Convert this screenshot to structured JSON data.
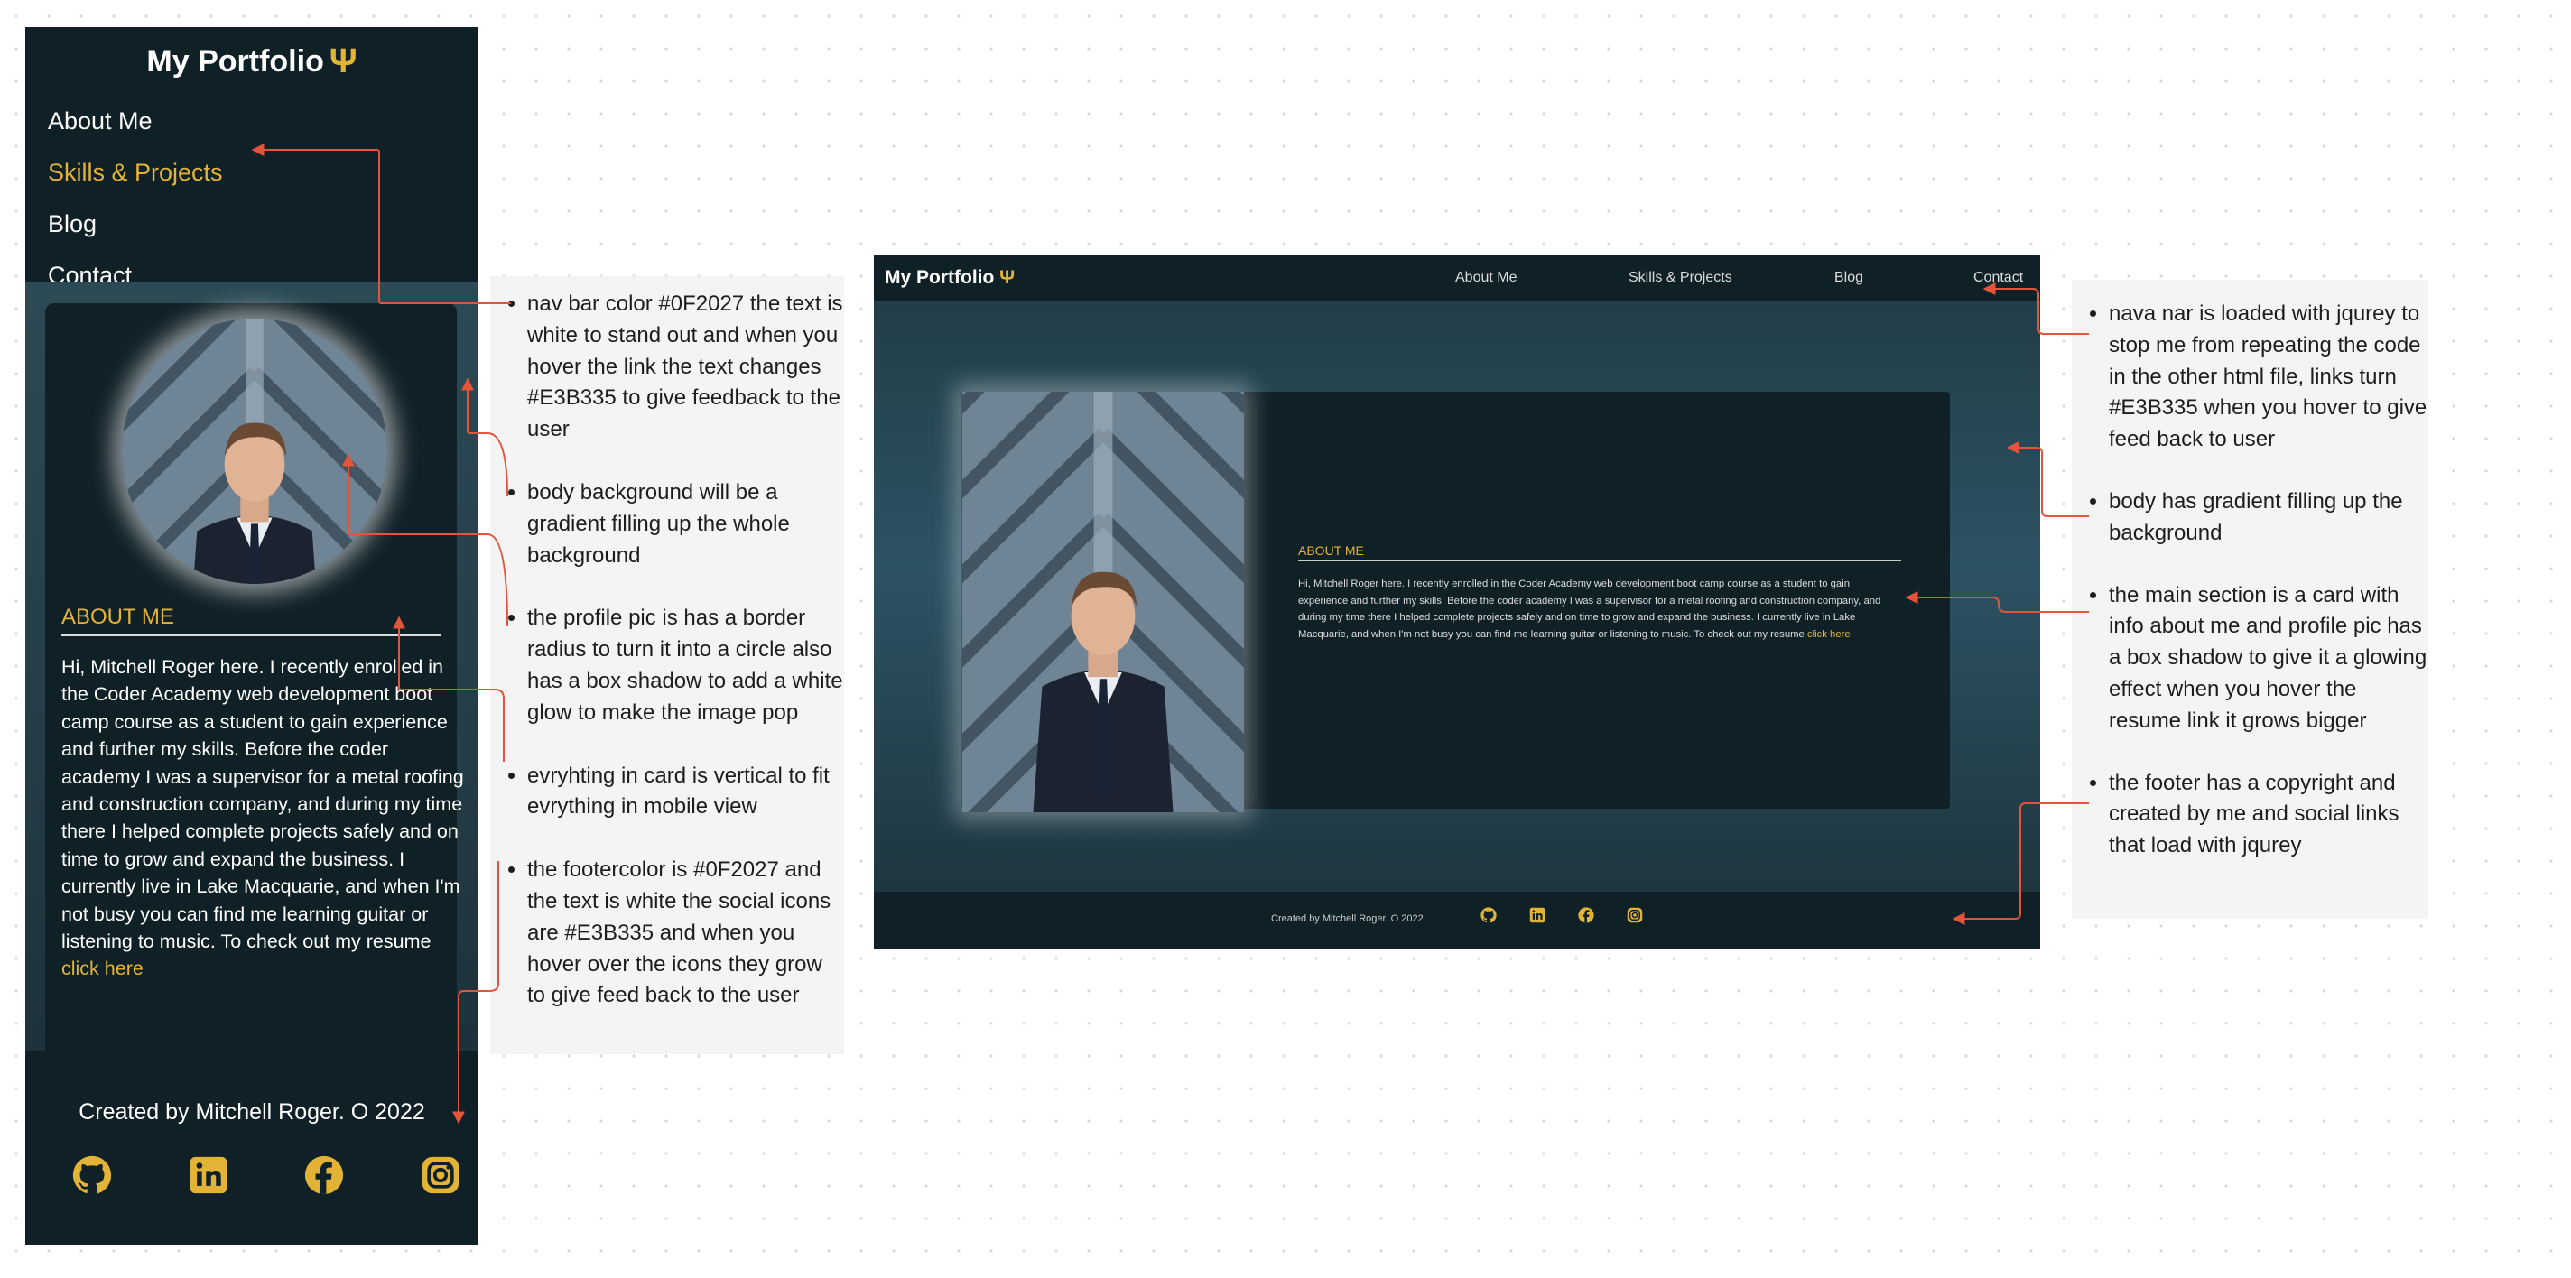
{
  "colors": {
    "navbar": "#0F2027",
    "accent": "#E3B335",
    "text": "#ffffff",
    "arrow": "#e4543a"
  },
  "mobile": {
    "logo_text": "My Portfolio",
    "logo_icon": "trident-icon",
    "nav": [
      "About Me",
      "Skills & Projects",
      "Blog",
      "Contact"
    ],
    "about_heading": "ABOUT ME",
    "about_text": "Hi, Mitchell Roger here. I recently enrolled in the Coder Academy web development boot camp course as a student to gain experience and further my skills. Before the coder academy I was a supervisor for a metal roofing and construction company, and during my time there I helped complete projects safely and on time to grow and expand the business. I currently live in Lake Macquarie, and when I'm not busy you can find me learning guitar or listening to music. To check out my resume",
    "resume_link": "click here",
    "footer_text": "Created by Mitchell Roger. O 2022",
    "social_icons": [
      "github-icon",
      "linkedin-icon",
      "facebook-icon",
      "instagram-icon"
    ]
  },
  "desktop": {
    "logo_text": "My Portfolio",
    "nav": [
      "About Me",
      "Skills & Projects",
      "Blog",
      "Contact"
    ],
    "about_heading": "ABOUT ME",
    "about_text": "Hi, Mitchell Roger here. I recently enrolled in the Coder Academy web development boot camp course as a student to gain experience and further my skills. Before the coder academy I was a supervisor for a metal roofing and construction company, and during my time there I helped complete projects safely and on time to grow and expand the business. I currently live in Lake Macquarie, and when I'm not busy you can find me learning guitar or listening to music. To check out my resume",
    "resume_link": "click here",
    "footer_text": "Created by Mitchell Roger. O 2022",
    "social_icons": [
      "github-icon",
      "linkedin-icon",
      "facebook-icon",
      "instagram-icon"
    ]
  },
  "notes_left": [
    "nav bar color  #0F2027  the text is white to stand out and when you hover the link the text changes #E3B335 to give feedback to the user",
    "body background will be a gradient filling up the whole background",
    "the profile pic is has a border radius to turn it into a circle also has a box shadow to add a white glow to make the image pop",
    "evryhting in card is vertical to fit evrything in mobile view",
    "the footercolor is #0F2027 and the text is white  the social icons are #E3B335  and when you hover over the icons they grow to give feed back to the user"
  ],
  "notes_right": [
    " nava nar is loaded with jqurey to stop me from repeating the code in the other html file, links turn #E3B335 when you hover to give feed back to user",
    "body has gradient filling up the background",
    "the main section is a card with info about me and profile pic has a box shadow to give it a glowing effect when you hover the resume link it grows bigger",
    "the footer has a copyright and created by me and social links that load with jqurey"
  ]
}
